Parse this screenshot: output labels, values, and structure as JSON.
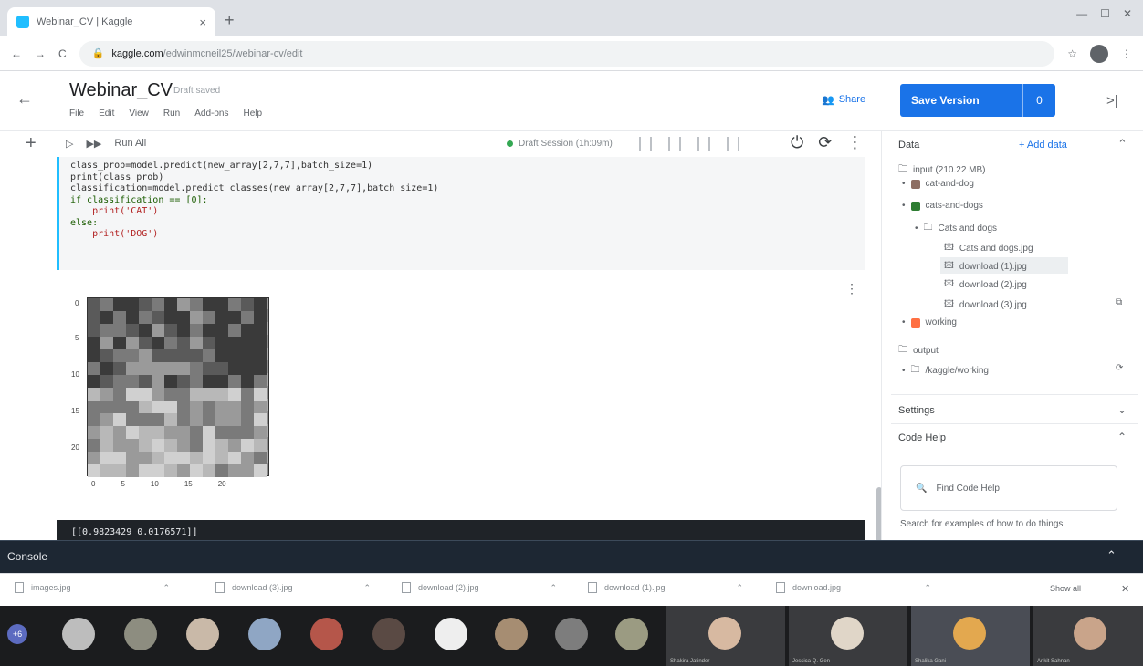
{
  "browser": {
    "tab_title": "Webinar_CV | Kaggle",
    "url_domain": "kaggle.com",
    "url_path": "/edwinmcneil25/webinar-cv/edit"
  },
  "notebook": {
    "title": "Webinar_CV",
    "status": "Draft saved",
    "menu": [
      "File",
      "Edit",
      "View",
      "Run",
      "Add-ons",
      "Help"
    ],
    "share_label": "Share",
    "save_label": "Save Version",
    "save_count": "0",
    "run_all_label": "Run All",
    "session_label": "Draft Session (1h:09m)"
  },
  "code": {
    "lines": [
      "class_prob=model.predict(new_array[2,7,7],batch_size=1)",
      "print(class_prob)",
      "classification=model.predict_classes(new_array[2,7,7],batch_size=1)",
      "if classification == [0]:",
      "    print('CAT')",
      "else:",
      "    print('DOG')"
    ],
    "output_text": "[[0.9823429 0.0176571]]"
  },
  "plot": {
    "y_ticks": [
      "0",
      "5",
      "10",
      "15",
      "20"
    ],
    "x_ticks": [
      "0",
      "5",
      "10",
      "15",
      "20"
    ]
  },
  "data_panel": {
    "header": "Data",
    "add_data": "+ Add data",
    "input_label": "input (210.22 MB)",
    "datasets": [
      {
        "name": "cat-and-dog",
        "color": "#8d6e63"
      },
      {
        "name": "cats-and-dogs",
        "color": "#2e7d32"
      }
    ],
    "folder": "Cats and dogs",
    "files": [
      "Cats and dogs.jpg",
      "download (1).jpg",
      "download (2).jpg",
      "download (3).jpg"
    ],
    "working": "working",
    "output_label": "output",
    "output_folder": "/kaggle/working",
    "settings": "Settings",
    "code_help": "Code Help",
    "find_code_help": "Find Code Help",
    "search_hint": "Search for examples of how to do things"
  },
  "console": {
    "label": "Console"
  },
  "downloads": [
    {
      "name": "images.jpg"
    },
    {
      "name": "download (3).jpg"
    },
    {
      "name": "download (2).jpg"
    },
    {
      "name": "download (1).jpg"
    },
    {
      "name": "download.jpg"
    }
  ],
  "downloads_show_all": "Show all",
  "meeting": {
    "self_badge": "+6",
    "tile_names": [
      "Shakira Jatinder",
      "Jessica Q. Gen",
      "Shalika Gani",
      "Ankit Sahnan"
    ]
  },
  "colors": {
    "accent": "#1a73e8",
    "kaggle_blue": "#20beff",
    "console_bg": "#1d2733"
  }
}
